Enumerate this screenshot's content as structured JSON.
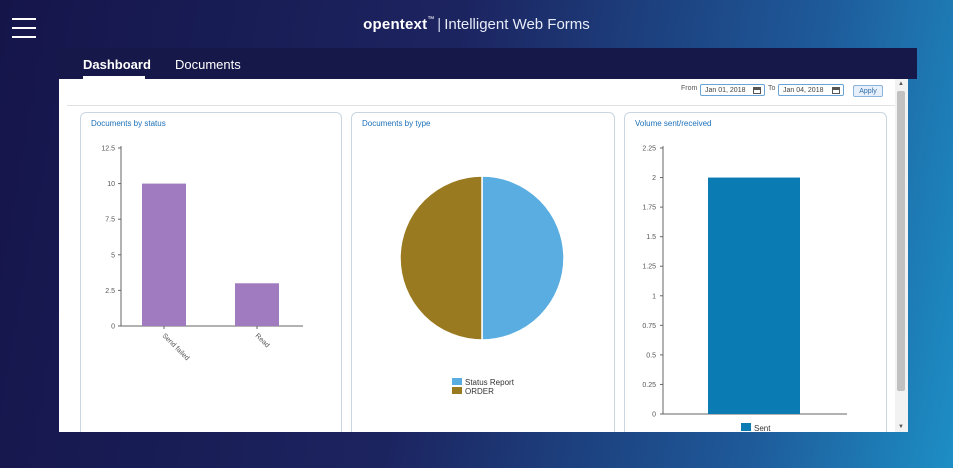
{
  "header": {
    "brand": "opentext",
    "trademark": "™",
    "separator": "|",
    "product": "Intelligent Web Forms"
  },
  "nav": {
    "tabs": [
      {
        "label": "Dashboard",
        "active": true
      },
      {
        "label": "Documents",
        "active": false
      }
    ]
  },
  "filter": {
    "from_label": "From",
    "from_value": "Jan 01, 2018",
    "to_label": "To",
    "to_value": "Jan 04, 2018",
    "apply_label": "Apply"
  },
  "colors": {
    "status_bar": "#a07bbf",
    "pie_status_report": "#5aade0",
    "pie_order": "#9a7a20",
    "volume_bar": "#0b7bb4",
    "card_title": "#1b6fb8"
  },
  "cards": [
    {
      "title": "Documents by status"
    },
    {
      "title": "Documents by type"
    },
    {
      "title": "Volume sent/received"
    }
  ],
  "chart_data": [
    {
      "type": "bar",
      "title": "Documents by status",
      "categories": [
        "Send failed",
        "Read"
      ],
      "values": [
        10,
        3
      ],
      "ylim": [
        0,
        12.5
      ],
      "yticks": [
        "0",
        "2.5",
        "5",
        "7.5",
        "10",
        "12.5"
      ],
      "grid": false
    },
    {
      "type": "pie",
      "title": "Documents by type",
      "labels": [
        "Status Report",
        "ORDER"
      ],
      "values": [
        1,
        1
      ],
      "legend": "bottom"
    },
    {
      "type": "bar",
      "title": "Volume sent/received",
      "categories": [
        ""
      ],
      "series": [
        {
          "name": "Sent",
          "values": [
            2
          ]
        }
      ],
      "ylim": [
        0,
        2.25
      ],
      "yticks": [
        "0",
        "0.25",
        "0.5",
        "0.75",
        "1",
        "1.25",
        "1.5",
        "1.75",
        "2",
        "2.25"
      ],
      "legend": "bottom",
      "grid": false
    }
  ]
}
